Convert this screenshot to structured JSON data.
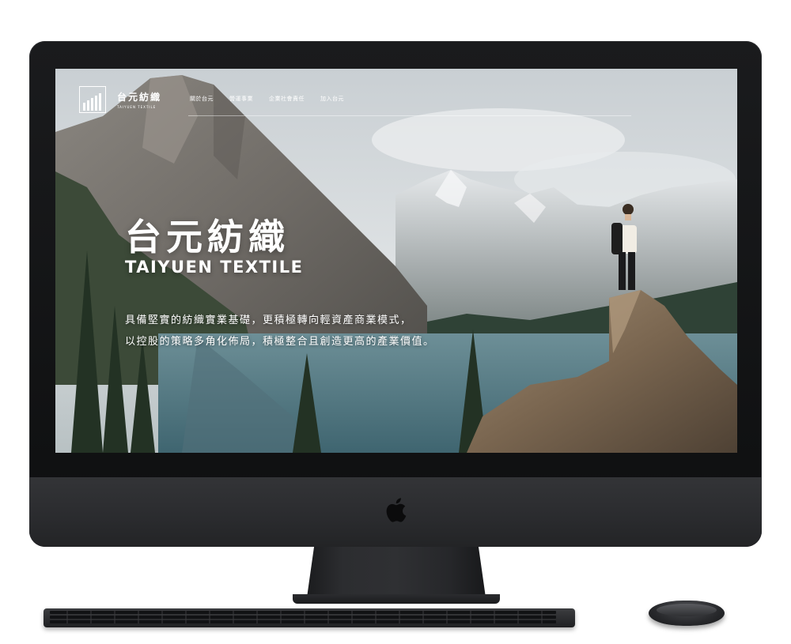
{
  "brand": {
    "name_cn": "台元紡織",
    "name_en": "TAIYUEN TEXTILE",
    "logo_icon": "bar-chart-logo-icon"
  },
  "nav": {
    "items": [
      {
        "label": "關於台元"
      },
      {
        "label": "營運事業"
      },
      {
        "label": "企業社會責任"
      },
      {
        "label": "加入台元"
      }
    ]
  },
  "hero": {
    "title_cn": "台元紡織",
    "title_en": "TAIYUEN TEXTILE",
    "desc_line1": "具備堅實的紡織實業基礎，更積極轉向輕資產商業模式，",
    "desc_line2": "以控股的策略多角化佈局，積極整合且創造更高的產業價值。"
  },
  "device": {
    "logo_icon": "apple-logo-icon"
  },
  "colors": {
    "frame": "#111214",
    "chin": "#2e2f32",
    "text": "#ffffff",
    "lake": "#4f7480"
  }
}
